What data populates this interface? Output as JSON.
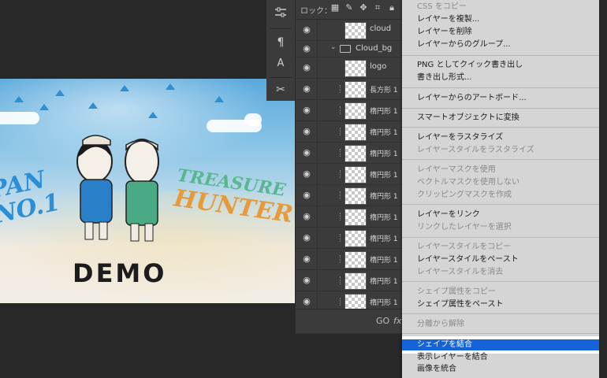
{
  "canvas": {
    "text_left_1": "PAN",
    "text_left_2": "NO.1",
    "text_right_1": "TREASURE",
    "text_right_2": "HUNTER",
    "demo": "DEMO"
  },
  "toolbar": {
    "icons": [
      "properties-icon",
      "paragraph-icon",
      "character-icon",
      "tools-icon"
    ]
  },
  "layers": {
    "lock_label": "ロック：",
    "rows": [
      {
        "name": "cloud",
        "type": "layer"
      },
      {
        "name": "Cloud_bg",
        "type": "group"
      },
      {
        "name": "logo",
        "type": "layer"
      },
      {
        "name": "長方形 1",
        "type": "shape"
      },
      {
        "name": "楕円形 1",
        "type": "shape"
      },
      {
        "name": "楕円形 1",
        "type": "shape"
      },
      {
        "name": "楕円形 1",
        "type": "shape"
      },
      {
        "name": "楕円形 1",
        "type": "shape"
      },
      {
        "name": "楕円形 1",
        "type": "shape"
      },
      {
        "name": "楕円形 1",
        "type": "shape"
      },
      {
        "name": "楕円形 1",
        "type": "shape"
      },
      {
        "name": "楕円形 1",
        "type": "shape"
      },
      {
        "name": "楕円形 1",
        "type": "shape"
      },
      {
        "name": "楕円形 1",
        "type": "shape"
      },
      {
        "name": "楕円形 1",
        "type": "shape"
      }
    ],
    "bottom_link": "GO",
    "bottom_fx": "fx"
  },
  "menu": {
    "items": [
      {
        "label": "CSS をコピー",
        "disabled": true
      },
      {
        "label": "レイヤーを複製...",
        "disabled": false
      },
      {
        "label": "レイヤーを削除",
        "disabled": false
      },
      {
        "label": "レイヤーからのグループ...",
        "disabled": false
      },
      {
        "label": "PNG としてクイック書き出し",
        "disabled": false
      },
      {
        "label": "書き出し形式...",
        "disabled": false
      },
      {
        "label": "レイヤーからのアートボード...",
        "disabled": false
      },
      {
        "label": "スマートオブジェクトに変換",
        "disabled": false
      },
      {
        "label": "レイヤーをラスタライズ",
        "disabled": false
      },
      {
        "label": "レイヤースタイルをラスタライズ",
        "disabled": true
      },
      {
        "label": "レイヤーマスクを使用",
        "disabled": true
      },
      {
        "label": "ベクトルマスクを使用しない",
        "disabled": true
      },
      {
        "label": "クリッピングマスクを作成",
        "disabled": true
      },
      {
        "label": "レイヤーをリンク",
        "disabled": false
      },
      {
        "label": "リンクしたレイヤーを選択",
        "disabled": true
      },
      {
        "label": "レイヤースタイルをコピー",
        "disabled": true
      },
      {
        "label": "レイヤースタイルをペースト",
        "disabled": false
      },
      {
        "label": "レイヤースタイルを消去",
        "disabled": true
      },
      {
        "label": "シェイプ属性をコピー",
        "disabled": true
      },
      {
        "label": "シェイプ属性をペースト",
        "disabled": false
      },
      {
        "label": "分離から解除",
        "disabled": true
      },
      {
        "label": "シェイプを結合",
        "disabled": false,
        "highlighted": true
      },
      {
        "label": "表示レイヤーを結合",
        "disabled": false
      },
      {
        "label": "画像を統合",
        "disabled": false
      }
    ],
    "highlight_color": "#1463d8"
  }
}
